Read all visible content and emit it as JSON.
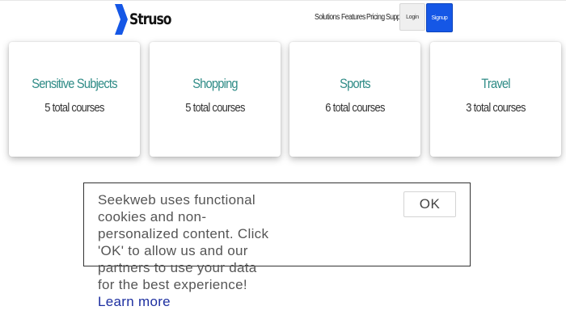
{
  "header": {
    "brand": "Struso",
    "nav": [
      "Solutions",
      "Features",
      "Pricing",
      "Support"
    ],
    "login_label": "Login",
    "signup_label": "Signup"
  },
  "categories": [
    {
      "title": "Sensitive Subjects",
      "count": "5 total courses"
    },
    {
      "title": "Shopping",
      "count": "5 total courses"
    },
    {
      "title": "Sports",
      "count": "6 total courses"
    },
    {
      "title": "Travel",
      "count": "3 total courses"
    }
  ],
  "cookie_banner": {
    "lines": [
      "Seekweb uses functional",
      "cookies and non-",
      "personalized content. Click",
      "'OK' to allow us and our",
      "partners to use your data",
      "for the best experience!"
    ],
    "learn_more_label": "Learn more",
    "ok_label": "OK"
  },
  "colors": {
    "brand_mark": "#1557e6",
    "card_title": "#2e8b86",
    "signup_button": "#1557e6",
    "link": "#1d2fa0"
  },
  "icons": {
    "brand_logo": "struso-logo-icon"
  }
}
